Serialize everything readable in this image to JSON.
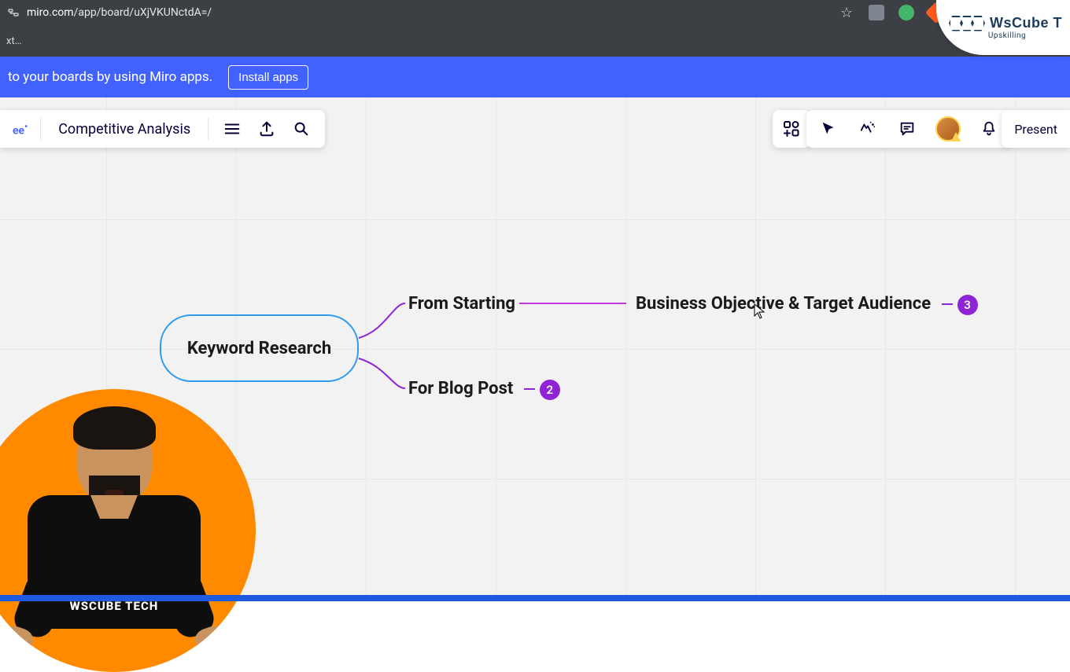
{
  "browser": {
    "url_domain": "miro.com",
    "url_path": "/app/board/uXjVKUNctdA=/",
    "bookmark_truncated": "xt…"
  },
  "watermark": {
    "brand": "WsCube T",
    "tagline": "Upskilling"
  },
  "promo": {
    "text": "to your boards by using Miro apps.",
    "button": "Install apps"
  },
  "toolbar": {
    "plan_label": "ee",
    "board_name": "Competitive Analysis",
    "present_label": "Present"
  },
  "mindmap": {
    "root": "Keyword Research",
    "branch1": "From Starting",
    "branch2": "For Blog Post",
    "branch2_count": "2",
    "branch1_child": "Business Objective & Target Audience",
    "branch1_child_count": "3"
  },
  "presenter_shirt": "WSCUBE TECH"
}
